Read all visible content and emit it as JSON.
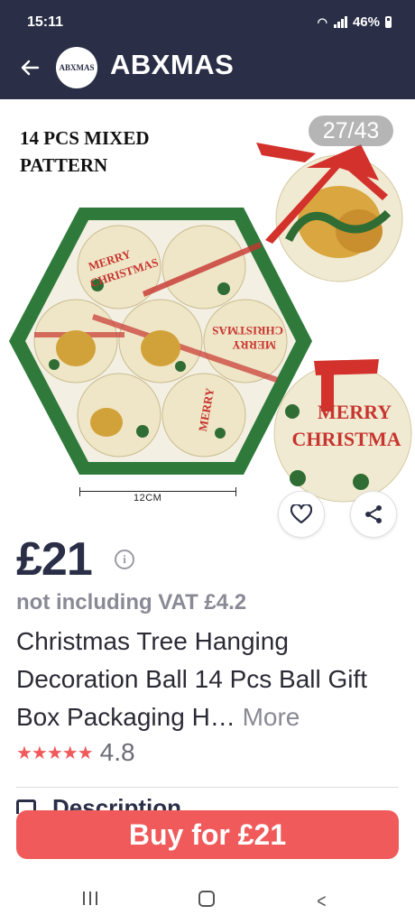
{
  "status_bar": {
    "time": "15:11",
    "battery": "46%"
  },
  "header": {
    "logo_text": "ABXMAS",
    "shop_name": "ABXMAS"
  },
  "gallery": {
    "image_title_line1": "14 PCS MIXED",
    "image_title_line2": "PATTERN",
    "counter": "27/43",
    "dimension_label": "12CM",
    "ornament_text_line1": "MERRY",
    "ornament_text_line2": "CHRISTMA"
  },
  "product": {
    "price": "£21",
    "vat": "not including VAT £4.2",
    "title": "Christmas Tree Hanging Decoration Ball 14 Pcs Ball Gift Box Packaging H…",
    "more": "More",
    "rating": "4.8",
    "stars": "★★★★★"
  },
  "description": {
    "label": "Description"
  },
  "buy_button": {
    "label": "Buy for £21"
  },
  "colors": {
    "header": "#2a2f47",
    "accent": "#f05a5b",
    "muted": "#8a8a96"
  },
  "icons": [
    "back-arrow-icon",
    "info-icon",
    "heart-icon",
    "share-icon",
    "description-icon",
    "recent-apps-icon",
    "home-icon",
    "back-nav-icon"
  ]
}
